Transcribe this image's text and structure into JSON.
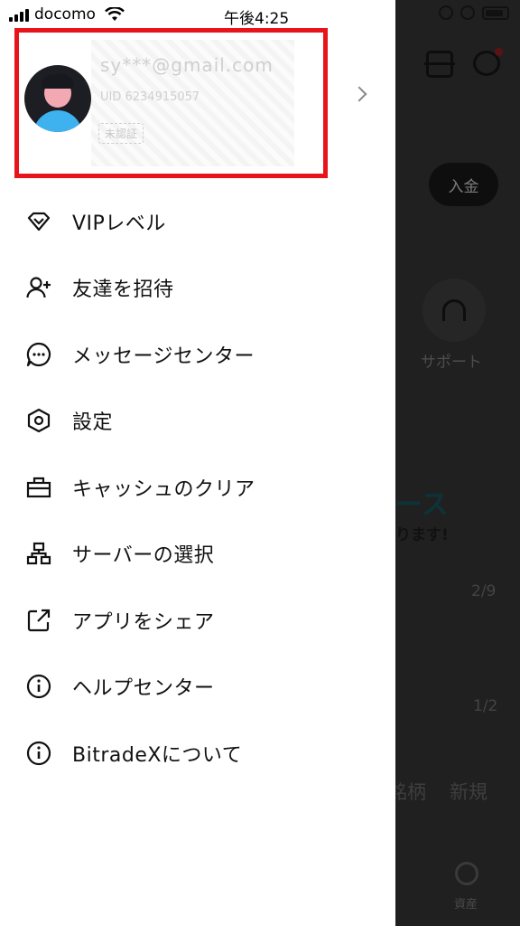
{
  "status_bar": {
    "carrier": "docomo",
    "time": "午後4:25"
  },
  "profile": {
    "email": "sy***@gmail.com",
    "uid": "UID 6234915057",
    "badge": "未認証"
  },
  "menu": {
    "items": [
      {
        "label": "VIPレベル",
        "icon": "diamond-icon"
      },
      {
        "label": "友達を招待",
        "icon": "add-user-icon"
      },
      {
        "label": "メッセージセンター",
        "icon": "chat-bubble-icon"
      },
      {
        "label": "設定",
        "icon": "settings-hexagon-icon"
      },
      {
        "label": "キャッシュのクリア",
        "icon": "toolbox-icon"
      },
      {
        "label": "サーバーの選択",
        "icon": "network-icon"
      },
      {
        "label": "アプリをシェア",
        "icon": "share-icon"
      },
      {
        "label": "ヘルプセンター",
        "icon": "info-icon"
      },
      {
        "label": "BitradeXについて",
        "icon": "info-icon"
      }
    ]
  },
  "background_app": {
    "deposit_button": "入金",
    "support_label": "サポート",
    "news_title": "ース",
    "news_subtitle": "ります!",
    "page_indicator_1": "2/9",
    "page_indicator_2": "1/2",
    "tab_1": "銘柄",
    "tab_2": "新規",
    "bottom_nav_label": "資産"
  },
  "colors": {
    "highlight_border": "#e8141c",
    "avatar_body": "#3eb2ef",
    "avatar_face": "#f2a9b2"
  }
}
